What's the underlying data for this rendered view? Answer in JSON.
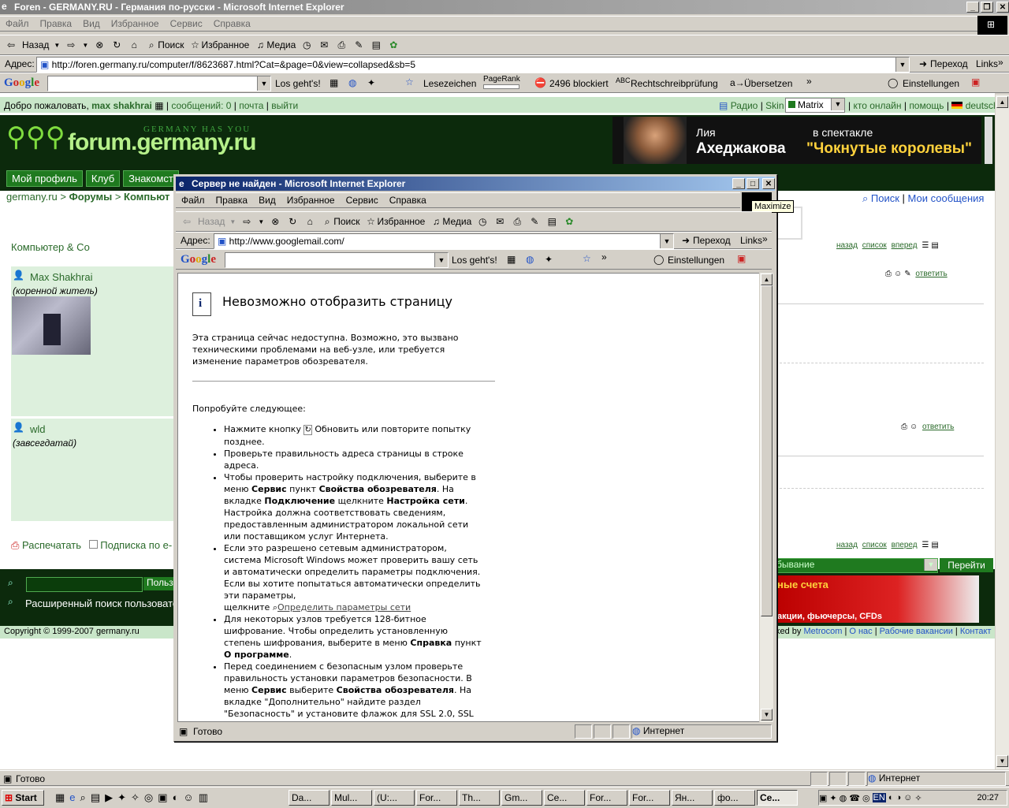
{
  "main_window": {
    "title": "Foren - GERMANY.RU - Германия по-русски - Microsoft Internet Explorer",
    "menu": [
      "Файл",
      "Правка",
      "Вид",
      "Избранное",
      "Сервис",
      "Справка"
    ],
    "toolbar": {
      "back": "Назад",
      "search": "Поиск",
      "favorites": "Избранное",
      "media": "Медиа"
    },
    "address_label": "Адрес:",
    "address_value": "http://foren.germany.ru/computer/f/8623687.html?Cat=&page=0&view=collapsed&sb=5",
    "go_label": "Переход",
    "links_label": "Links",
    "google_bar": {
      "search_button": "Los geht's!",
      "bookmarks": "Lesezeichen",
      "pagerank": "PageRank",
      "blocked": "2496 blockiert",
      "spellcheck": "Rechtschreibprüfung",
      "translate": "Übersetzen",
      "settings": "Einstellungen"
    },
    "status_text": "Готово",
    "status_zone": "Интернет"
  },
  "page": {
    "welcome": "Добро пожаловать,",
    "username": "max shakhrai",
    "messages": "сообщений: 0",
    "mail": "почта",
    "logout": "выйти",
    "radio": "Радио",
    "skin": "Skin",
    "skin_value": "Matrix",
    "online": "кто онлайн",
    "help": "помощь",
    "lang": "deutsch",
    "logo_tagline": "GERMANY HAS YOU",
    "logo_text": "forum.germany.ru",
    "banner_name_line1": "Лия",
    "banner_name_line2": "Ахеджакова",
    "banner_play_line1": "в спектакле",
    "banner_play_line2": "\"Чокнутые королевы\"",
    "nav_tabs": [
      "Мой профиль",
      "Клуб",
      "Знакомст"
    ],
    "breadcrumb_site": "germany.ru",
    "breadcrumb_forums": "Форумы",
    "breadcrumb_section": "Компьют",
    "search_link": "Поиск",
    "my_messages": "Мои сообщения",
    "forum_name": "Компьютер & Co",
    "post1_author": "Max Shakhrai",
    "post1_status": "(коренной житель)",
    "post2_author": "wld",
    "post2_status": "(завсегдатай)",
    "nav_back": "назад",
    "nav_list": "список",
    "nav_forward": "вперед",
    "reply": "ответить",
    "print": "Распечатать",
    "subscribe": "Подписка по е-",
    "user_search_btn": "Польз",
    "advanced_search": "Расширенный поиск пользовате",
    "sort_value": "бывание",
    "go_button": "Перейти",
    "ad_text1": "ные счета",
    "ad_text2": "акции, фьючерсы, CFDs",
    "copyright": "Copyright © 1999-2007 germany.ru",
    "footer_powered": "ked by",
    "footer_metrocom": "Metrocom",
    "footer_about": "О нас",
    "footer_jobs": "Рабочие вакансии",
    "footer_contact": "Контакт"
  },
  "dialog": {
    "title": "Сервер не найден - Microsoft Internet Explorer",
    "tooltip": "Maximize",
    "menu": [
      "Файл",
      "Правка",
      "Вид",
      "Избранное",
      "Сервис",
      "Справка"
    ],
    "toolbar": {
      "back": "Назад",
      "search": "Поиск",
      "favorites": "Избранное",
      "media": "Медиа"
    },
    "address_label": "Адрес:",
    "address_value": "http://www.googlemail.com/",
    "go_label": "Переход",
    "links_label": "Links",
    "google_search_button": "Los geht's!",
    "google_settings": "Einstellungen",
    "heading": "Невозможно отобразить страницу",
    "intro": "Эта страница сейчас недоступна. Возможно, это вызвано техническими проблемами на веб-узле, или требуется изменение параметров обозревателя.",
    "try_label": "Попробуйте следующее:",
    "item1_a": "Нажмите кнопку",
    "item1_b": "Обновить или повторите попытку позднее.",
    "item2": "Проверьте правильность адреса страницы в строке адреса.",
    "item3_a": "Чтобы проверить настройку подключения, выберите в меню",
    "item3_menu": "Сервис",
    "item3_b": "пункт",
    "item3_opt": "Свойства обозревателя",
    "item3_c": ". На вкладке",
    "item3_tab": "Подключение",
    "item3_d": "щелкните",
    "item3_btn": "Настройка сети",
    "item3_e": ". Настройка должна соответствовать сведениям, предоставленным администратором локальной сети или поставщиком услуг Интернета.",
    "item4": "Если это разрешено сетевым администратором, система Microsoft Windows может проверить вашу сеть и автоматически определить параметры подключения. Если вы хотите попытаться автоматически определить эти параметры,",
    "item4_click": "щелкните",
    "item4_link": "Определить параметры сети",
    "item5_a": "Для некоторых узлов требуется 128-битное шифрование. Чтобы определить установленную степень шифрования, выберите в меню",
    "item5_menu": "Справка",
    "item5_b": "пункт",
    "item5_opt": "О программе",
    "item6_a": "Перед соединением с безопасным узлом проверьте правильность установки параметров безопасности. В меню",
    "item6_menu": "Сервис",
    "item6_b": "выберите",
    "item6_opt": "Свойства обозревателя",
    "item6_c": ". На вкладке \"Дополнительно\" найдите раздел \"Безопасность\" и установите флажок для SSL 2.0, SSL",
    "status_text": "Готово",
    "status_zone": "Интернет"
  },
  "taskbar": {
    "start": "Start",
    "tasks": [
      "Da...",
      "Mul...",
      "(U:...",
      "For...",
      "Th...",
      "Gm...",
      "Ce...",
      "For...",
      "For...",
      "Ян...",
      "фо...",
      "Се..."
    ],
    "lang": "EN",
    "clock": "20:27"
  }
}
